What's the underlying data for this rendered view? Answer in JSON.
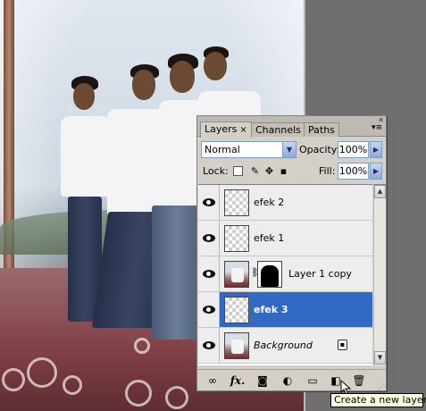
{
  "panel": {
    "tabs": [
      {
        "label": "Layers",
        "close": "×"
      },
      {
        "label": "Channels"
      },
      {
        "label": "Paths"
      }
    ],
    "blend_mode": "Normal",
    "opacity_label": "Opacity:",
    "opacity_value": "100%",
    "lock_label": "Lock:",
    "fill_label": "Fill:",
    "fill_value": "100%",
    "layers": [
      {
        "name": "efek 2",
        "visible": true,
        "selected": false,
        "thumb": "transparent"
      },
      {
        "name": "efek 1",
        "visible": true,
        "selected": false,
        "thumb": "transparent"
      },
      {
        "name": "Layer 1 copy",
        "visible": true,
        "selected": false,
        "thumb": "photo",
        "mask": true
      },
      {
        "name": "efek 3",
        "visible": true,
        "selected": true,
        "thumb": "transparent"
      },
      {
        "name": "Background",
        "visible": true,
        "selected": false,
        "thumb": "photo",
        "locked": true
      }
    ],
    "bottom_icons": [
      "link-icon",
      "fx-icon",
      "mask-icon",
      "adjustment-icon",
      "folder-icon",
      "new-layer-icon",
      "trash-icon"
    ],
    "fx_label": "fx.",
    "selection_color": "#316ac5"
  },
  "tooltip": {
    "text": "Create a new layer"
  }
}
